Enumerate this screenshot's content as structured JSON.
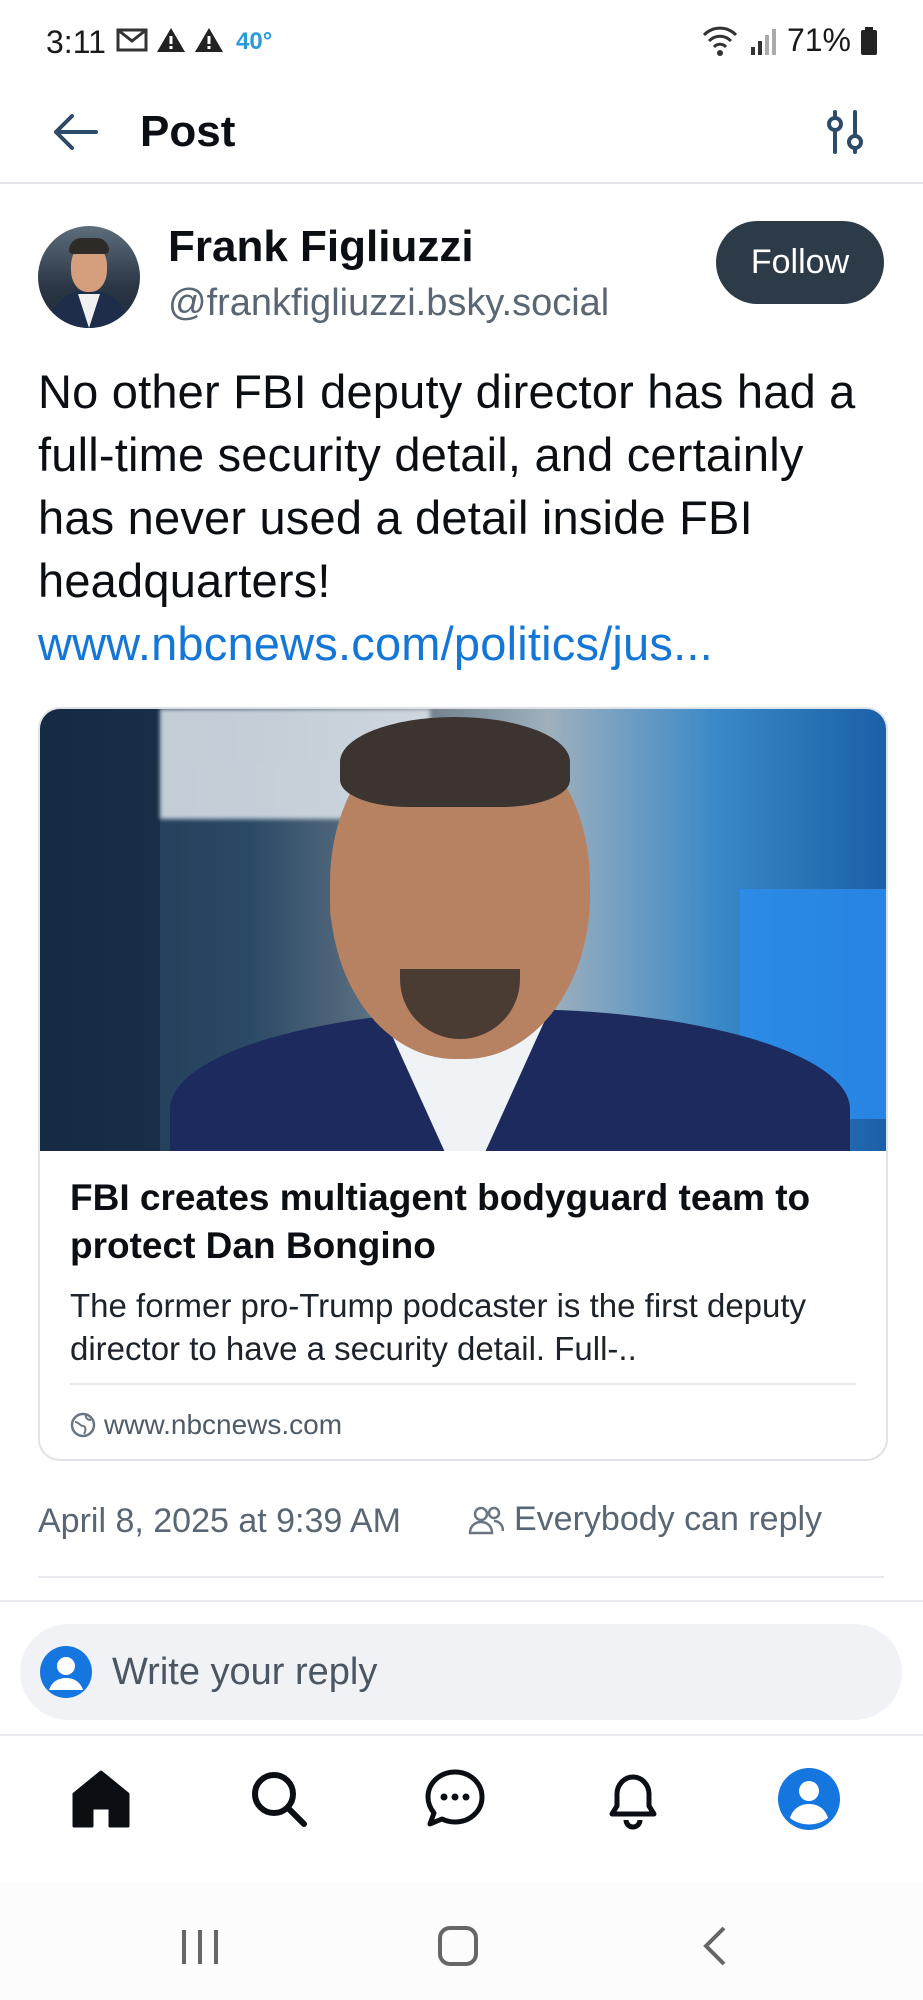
{
  "status_bar": {
    "time": "3:11",
    "temperature": "40°",
    "battery": "71%",
    "icons": [
      "gmail-icon",
      "warning-icon",
      "warning-icon",
      "wifi-icon",
      "signal-icon",
      "battery-icon"
    ]
  },
  "header": {
    "title": "Post",
    "icons": [
      "back-arrow-icon",
      "sliders-icon"
    ]
  },
  "post": {
    "author_name": "Frank Figliuzzi",
    "author_handle": "@frankfigliuzzi.bsky.social",
    "follow_label": "Follow",
    "text": "No other FBI deputy director has had a full-time security detail, and certainly has never used a detail inside FBI headquarters!",
    "link_text": "www.nbcnews.com/politics/jus...",
    "embed": {
      "title": "FBI creates multiagent bodyguard team to protect Dan Bongino",
      "description": "The former pro-Trump podcaster is the first deputy director to have a security detail. Full-..",
      "domain": "www.nbcnews.com"
    },
    "timestamp": "April 8, 2025 at 9:39 AM",
    "reply_setting": "Everybody can reply"
  },
  "reply_bar": {
    "placeholder": "Write your reply"
  },
  "bottom_nav": {
    "items": [
      "home-icon",
      "search-icon",
      "chat-icon",
      "bell-icon",
      "profile-icon"
    ]
  },
  "colors": {
    "link": "#1476d6",
    "follow_bg": "#2d3a48",
    "accent": "#1676e0"
  }
}
